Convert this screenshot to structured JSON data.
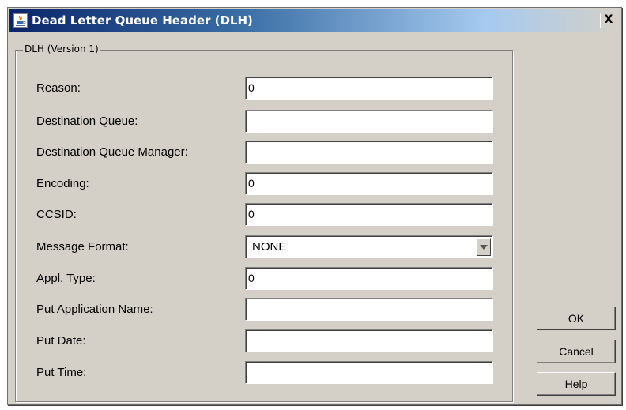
{
  "window": {
    "title": "Dead Letter Queue Header (DLH)",
    "close_label": "X",
    "icon": "java-cup-icon"
  },
  "group": {
    "legend": "DLH (Version 1)"
  },
  "fields": {
    "reason": {
      "label": "Reason:",
      "value": "0"
    },
    "destination_queue": {
      "label": "Destination Queue:",
      "value": ""
    },
    "destination_queue_manager": {
      "label": "Destination Queue Manager:",
      "value": ""
    },
    "encoding": {
      "label": "Encoding:",
      "value": "0"
    },
    "ccsid": {
      "label": "CCSID:",
      "value": "0"
    },
    "message_format": {
      "label": "Message Format:",
      "value": "NONE"
    },
    "appl_type": {
      "label": "Appl. Type:",
      "value": "0"
    },
    "put_application_name": {
      "label": "Put Application Name:",
      "value": ""
    },
    "put_date": {
      "label": "Put Date:",
      "value": ""
    },
    "put_time": {
      "label": "Put Time:",
      "value": ""
    }
  },
  "buttons": {
    "ok": "OK",
    "cancel": "Cancel",
    "help": "Help"
  },
  "colors": {
    "dialog_background": "#d4d0c8",
    "titlebar_start": "#0a246a",
    "titlebar_end": "#a6caf0",
    "field_background": "#ffffff"
  }
}
